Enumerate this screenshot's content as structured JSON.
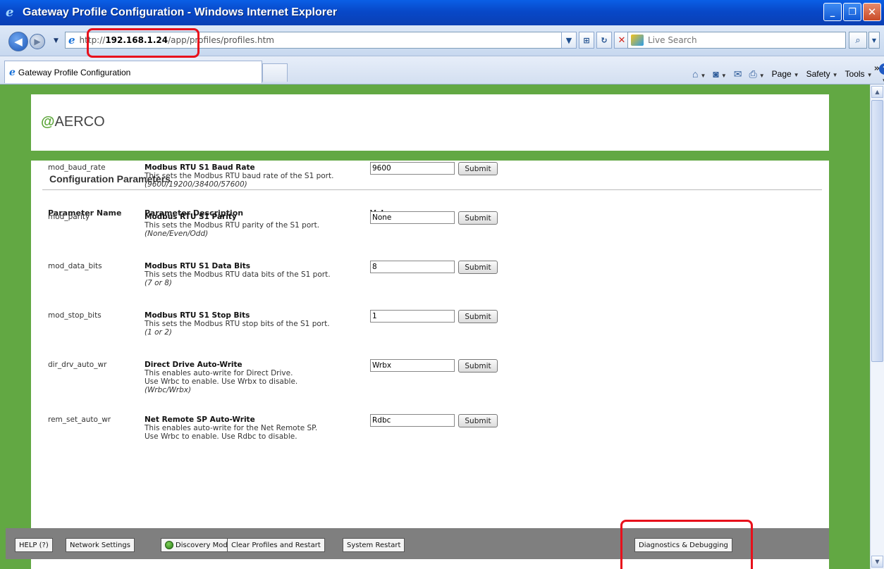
{
  "window": {
    "title": "Gateway Profile Configuration - Windows Internet Explorer",
    "minimize": "_",
    "maximize": "❐",
    "close": "✕"
  },
  "address_bar": {
    "url_prefix": "http://",
    "url_host": "192.168.1.24",
    "url_path": "/app/profiles/profiles.htm"
  },
  "search": {
    "placeholder": "Live Search"
  },
  "tab": {
    "label": "Gateway Profile Configuration"
  },
  "command_bar": {
    "page": "Page",
    "safety": "Safety",
    "tools": "Tools"
  },
  "page": {
    "logo": "AERCO",
    "section_title": "Configuration Parameters",
    "columns": {
      "name": "Parameter Name",
      "description": "Parameter Description",
      "value": "Value"
    },
    "submit_label": "Submit",
    "params": [
      {
        "name": "mod_baud_rate",
        "title": "Modbus RTU S1 Baud Rate",
        "lines": [
          "This sets the Modbus RTU baud rate of the S1 port."
        ],
        "options": "(9600/19200/38400/57600)",
        "value": "9600"
      },
      {
        "name": "mod_parity",
        "title": "Modbus RTU S1 Parity",
        "lines": [
          "This sets the Modbus RTU parity of the S1 port."
        ],
        "options": "(None/Even/Odd)",
        "value": "None"
      },
      {
        "name": "mod_data_bits",
        "title": "Modbus RTU S1 Data Bits",
        "lines": [
          "This sets the Modbus RTU data bits of the S1 port."
        ],
        "options": "(7 or 8)",
        "value": "8"
      },
      {
        "name": "mod_stop_bits",
        "title": "Modbus RTU S1 Stop Bits",
        "lines": [
          "This sets the Modbus RTU stop bits of the S1 port."
        ],
        "options": "(1 or 2)",
        "value": "1"
      },
      {
        "name": "dir_drv_auto_wr",
        "title": "Direct Drive Auto-Write",
        "lines": [
          "This enables auto-write for Direct Drive.",
          "Use Wrbc to enable. Use Wrbx to disable."
        ],
        "options": "(Wrbc/Wrbx)",
        "value": "Wrbx"
      },
      {
        "name": "rem_set_auto_wr",
        "title": "Net Remote SP Auto-Write",
        "lines": [
          "This enables auto-write for the Net Remote SP.",
          "Use Wrbc to enable. Use Rdbc to disable."
        ],
        "options": "",
        "value": "Rdbc"
      }
    ]
  },
  "bottom_toolbar": {
    "help": "HELP (?)",
    "network": "Network Settings",
    "discovery": "Discovery Mode",
    "clear": "Clear Profiles and Restart",
    "restart": "System Restart",
    "diagnostics": "Diagnostics & Debugging"
  },
  "colors": {
    "page_background": "#62a843",
    "highlight": "#e8101b",
    "title_bar": "#0a5fe6"
  }
}
